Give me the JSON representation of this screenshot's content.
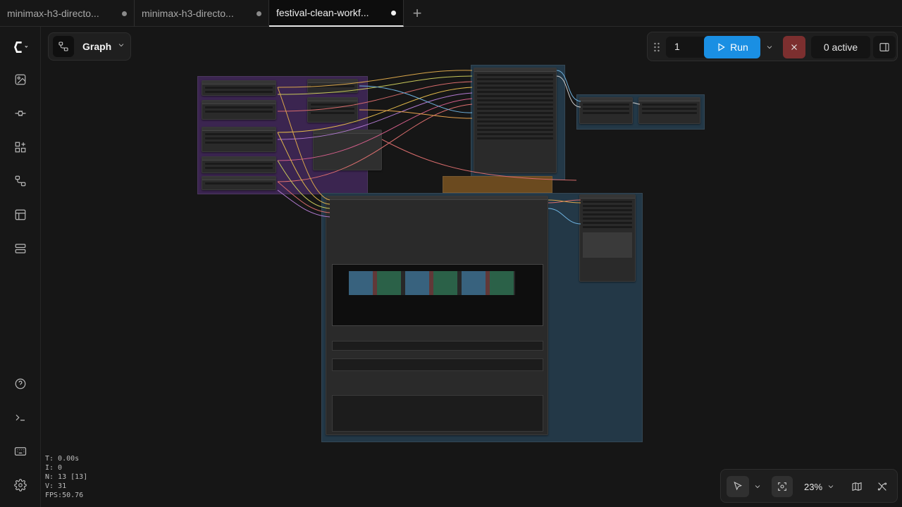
{
  "tabs": [
    {
      "label": "minimax-h3-directo...",
      "active": false
    },
    {
      "label": "minimax-h3-directo...",
      "active": false
    },
    {
      "label": "festival-clean-workf...",
      "active": true
    }
  ],
  "sidebar": {
    "items": [
      {
        "name": "logo",
        "icon": "comfy-logo-icon"
      },
      {
        "name": "assets",
        "icon": "image-icon"
      },
      {
        "name": "nodes",
        "icon": "node-library-icon"
      },
      {
        "name": "models",
        "icon": "model-library-icon"
      },
      {
        "name": "workflows",
        "icon": "workflow-icon"
      },
      {
        "name": "templates",
        "icon": "template-icon"
      },
      {
        "name": "queue",
        "icon": "queue-icon"
      },
      {
        "name": "help",
        "icon": "help-icon"
      },
      {
        "name": "terminal",
        "icon": "terminal-icon"
      },
      {
        "name": "keyboard",
        "icon": "keyboard-icon"
      },
      {
        "name": "settings",
        "icon": "gear-icon"
      }
    ]
  },
  "graph": {
    "label": "Graph"
  },
  "toolbar": {
    "batch_count": "1",
    "run_label": "Run",
    "active_label": "0 active"
  },
  "stats": {
    "t": "T: 0.00s",
    "i": "I: 0",
    "n": "N: 13 [13]",
    "v": "V: 31",
    "fps": "FPS:50.76"
  },
  "zoom": {
    "value": "23%"
  },
  "colors": {
    "accent": "#1a8fe3",
    "cancel": "#7c2f2f",
    "group_purple": "#3b2550",
    "group_blue": "#233847",
    "group_orange": "#6b4a1f"
  }
}
